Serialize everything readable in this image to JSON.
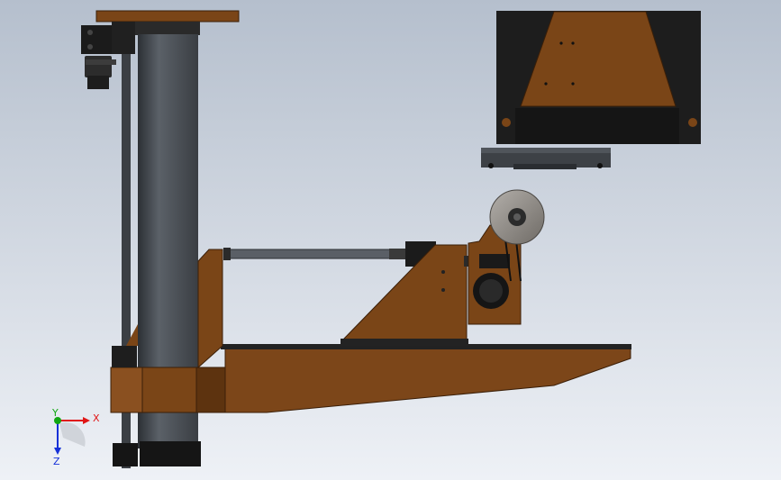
{
  "viewport": {
    "background_top": "#b7c1cf",
    "background_bottom": "#eef1f5"
  },
  "colors": {
    "brown": "#7a4517",
    "brown_dark": "#5a300c",
    "steel": "#4b5058",
    "steel_dark": "#2a2d31",
    "black": "#161616",
    "grey_disc": "#8d8a86"
  },
  "triad": {
    "x_label": "X",
    "y_label": "Y",
    "z_label": "Z",
    "x_color": "#e01616",
    "y_color": "#11a611",
    "z_color": "#1530d8"
  }
}
